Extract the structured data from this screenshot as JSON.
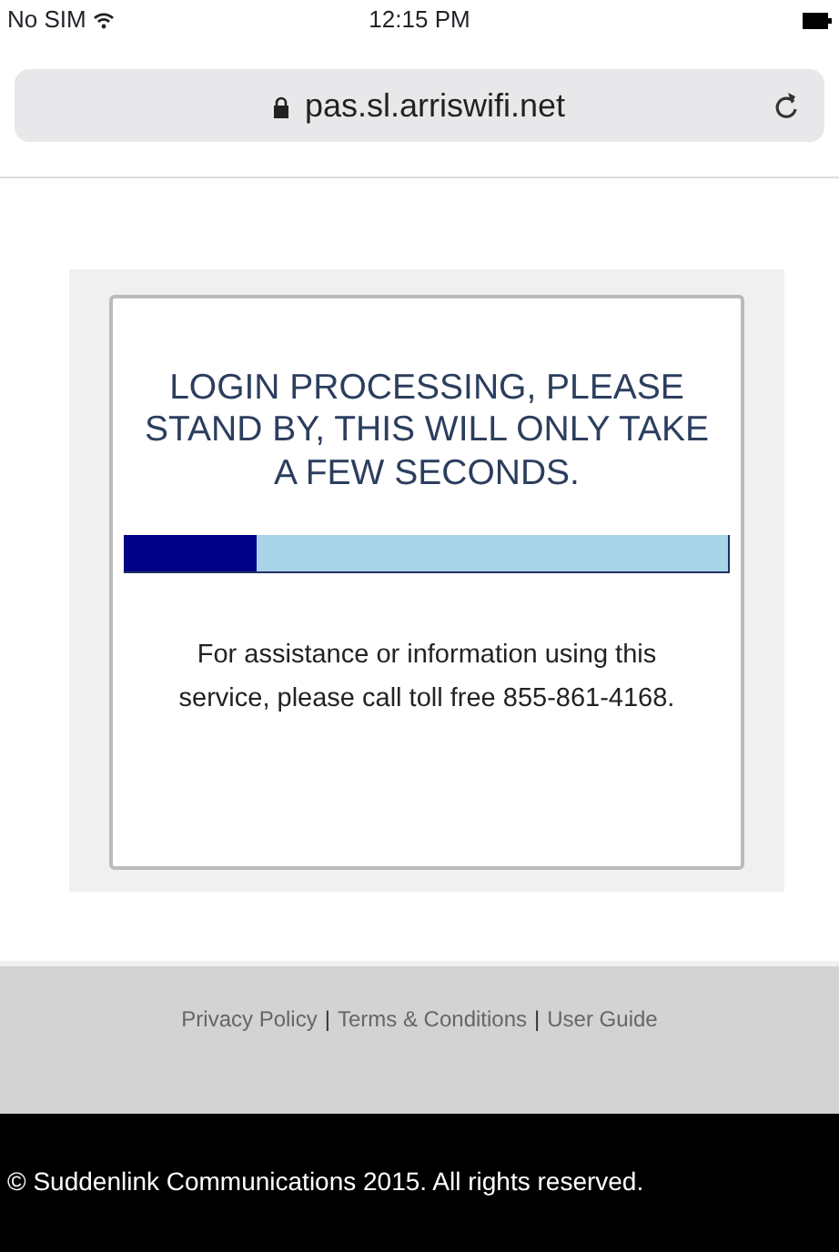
{
  "status_bar": {
    "carrier": "No SIM",
    "time": "12:15 PM"
  },
  "address_bar": {
    "url": "pas.sl.arriswifi.net",
    "secure": true
  },
  "message": {
    "heading": "LOGIN PROCESSING, PLEASE STAND BY, THIS WILL ONLY TAKE A FEW SECONDS.",
    "progress": {
      "level": 0.22
    },
    "note": "For assistance or information using this service, please call toll free 855-861-4168."
  },
  "footer": {
    "links": [
      "Privacy Policy",
      "Terms & Conditions",
      "User Guide"
    ],
    "separator": "|",
    "copyright": "© Suddenlink Communications 2015. All rights reserved."
  }
}
